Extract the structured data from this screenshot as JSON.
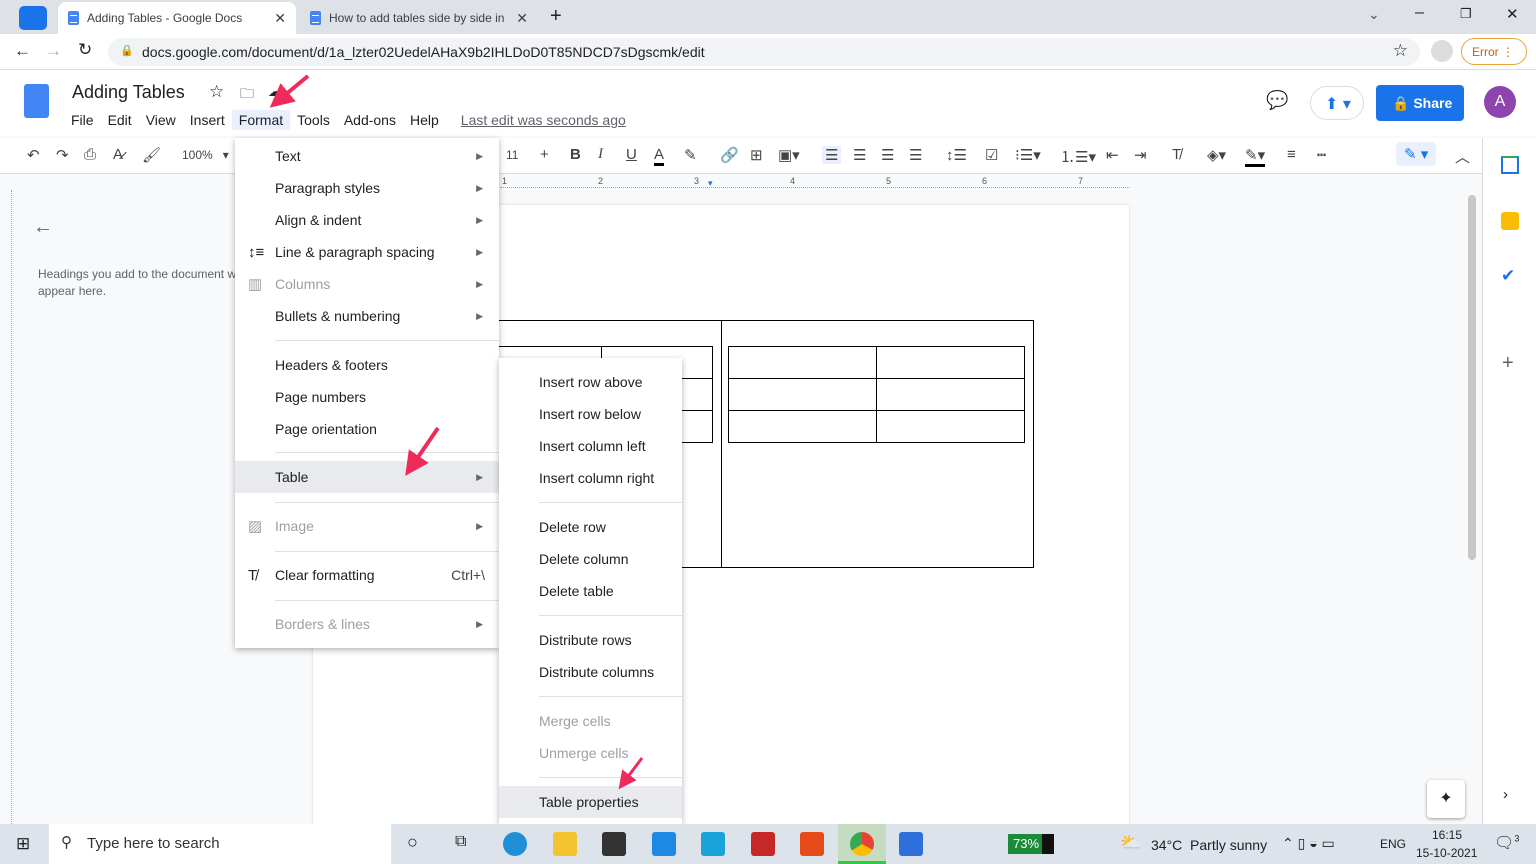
{
  "browser": {
    "tabs": [
      {
        "title": "Adding Tables - Google Docs",
        "active": true
      },
      {
        "title": "How to add tables side by side in"
      }
    ],
    "url": "docs.google.com/document/d/1a_lzter02UedelAHaX9b2IHLDoD0T85NDCD7sDgscmk/edit",
    "error_label": "Error"
  },
  "docs": {
    "title": "Adding Tables",
    "menus": [
      "File",
      "Edit",
      "View",
      "Insert",
      "Format",
      "Tools",
      "Add-ons",
      "Help"
    ],
    "last_edit": "Last edit was seconds ago",
    "share": "Share",
    "avatar": "A",
    "zoom": "100%",
    "font_size": "11",
    "accent": "#1a73e8"
  },
  "outline": {
    "text": "Headings you add to the document will appear here."
  },
  "ruler": [
    "1",
    "2",
    "3",
    "4",
    "5",
    "6",
    "7"
  ],
  "format_menu": [
    {
      "label": "Text",
      "arrow": true
    },
    {
      "label": "Paragraph styles",
      "arrow": true
    },
    {
      "label": "Align & indent",
      "arrow": true
    },
    {
      "label": "Line & paragraph spacing",
      "arrow": true
    },
    {
      "label": "Columns",
      "arrow": true,
      "disabled": true
    },
    {
      "label": "Bullets & numbering",
      "arrow": true
    },
    {
      "label": "Headers & footers"
    },
    {
      "label": "Page numbers"
    },
    {
      "label": "Page orientation"
    },
    {
      "label": "Table",
      "arrow": true,
      "highlighted": true
    },
    {
      "label": "Image",
      "arrow": true,
      "disabled": true
    },
    {
      "label": "Clear formatting",
      "shortcut": "Ctrl+\\"
    },
    {
      "label": "Borders & lines",
      "arrow": true,
      "disabled": true
    }
  ],
  "table_menu": [
    {
      "label": "Insert row above"
    },
    {
      "label": "Insert row below"
    },
    {
      "label": "Insert column left"
    },
    {
      "label": "Insert column right"
    },
    {
      "label": "Delete row"
    },
    {
      "label": "Delete column"
    },
    {
      "label": "Delete table"
    },
    {
      "label": "Distribute rows"
    },
    {
      "label": "Distribute columns"
    },
    {
      "label": "Merge cells",
      "disabled": true
    },
    {
      "label": "Unmerge cells",
      "disabled": true
    },
    {
      "label": "Table properties",
      "highlighted": true
    }
  ],
  "taskbar": {
    "search_placeholder": "Type here to search",
    "battery": "73%",
    "weather": "34°C  Partly sunny",
    "lang": "ENG",
    "time": "16:15",
    "date": "15-10-2021",
    "notif_count": "3"
  }
}
